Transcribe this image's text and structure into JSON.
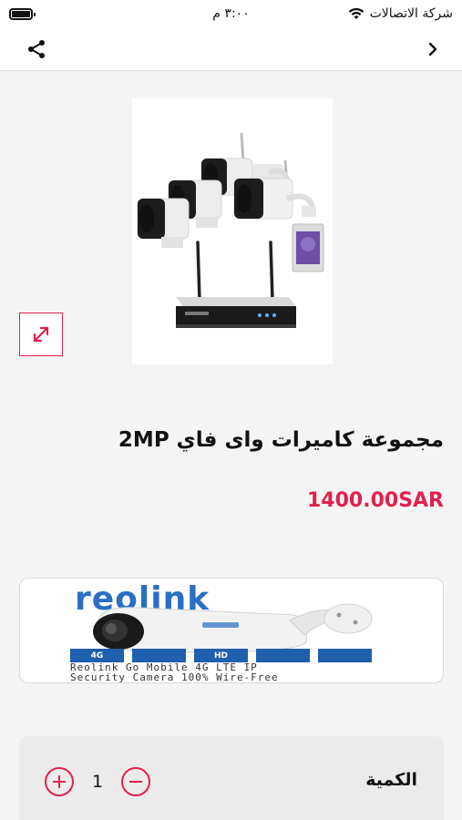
{
  "status_bar": {
    "carrier": "شركة الاتصالات",
    "time": "٣:٠٠ م"
  },
  "nav": {
    "back_icon": "chevron-right-icon",
    "share_icon": "share-icon"
  },
  "product": {
    "title": "مجموعة كاميرات واى فاي 2MP",
    "price": "1400.00SAR",
    "expand_icon": "expand-arrows-icon"
  },
  "banner": {
    "brand": "reolink",
    "features": [
      "4G",
      "",
      "HD",
      "",
      ""
    ],
    "caption_line1": "Reolink Go Mobile 4G LTE IP",
    "caption_line2": "Security Camera 100% Wire-Free"
  },
  "quantity": {
    "label": "الكمية",
    "value": "1"
  },
  "colors": {
    "accent": "#e0214e",
    "background": "#f5f4f4",
    "brand_blue": "#2a6fc4"
  }
}
